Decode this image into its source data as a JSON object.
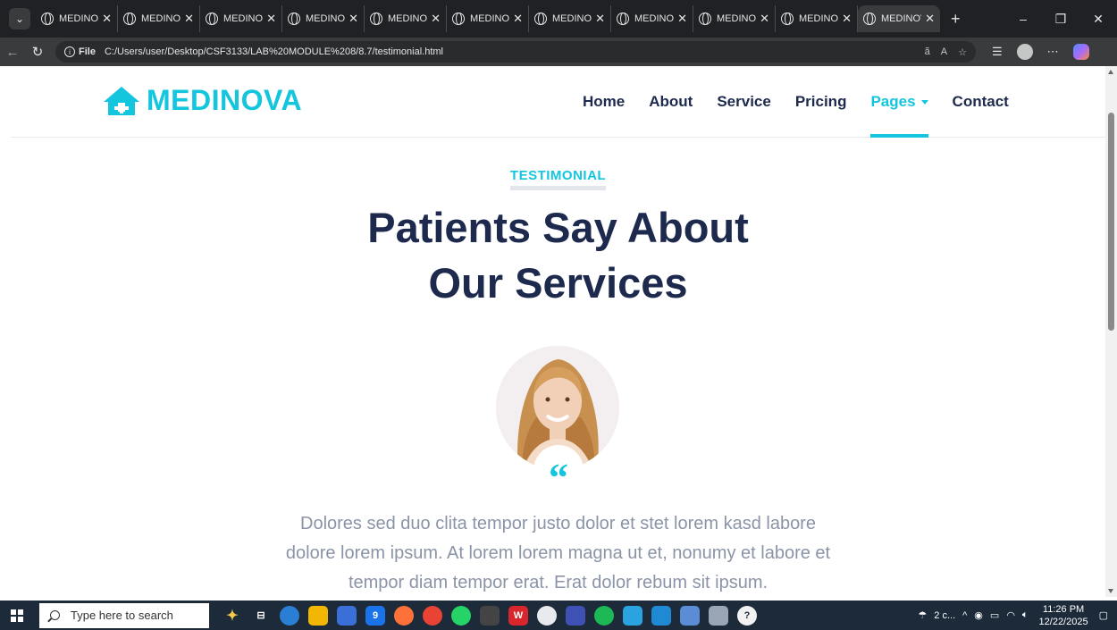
{
  "browser": {
    "tab_title": "MEDINOVA",
    "tab_count": 11,
    "new_tab_label": "+",
    "address": {
      "scheme_label": "File",
      "url": "C:/Users/user/Desktop/CSF3133/LAB%20MODULE%208/8.7/testimonial.html"
    }
  },
  "site": {
    "brand": "MEDINOVA",
    "nav": [
      {
        "label": "Home"
      },
      {
        "label": "About"
      },
      {
        "label": "Service"
      },
      {
        "label": "Pricing"
      },
      {
        "label": "Pages"
      },
      {
        "label": "Contact"
      }
    ],
    "section_tag": "TESTIMONIAL",
    "heading_line1": "Patients Say About",
    "heading_line2": "Our Services",
    "quote_mark": "“",
    "testimonial_line1": "Dolores sed duo clita tempor justo dolor et stet lorem kasd labore",
    "testimonial_line2": "dolore lorem ipsum. At lorem lorem magna ut et, nonumy et labore et",
    "testimonial_line3": "tempor diam tempor erat. Erat dolor rebum sit ipsum."
  },
  "colors": {
    "accent": "#13c5dd",
    "heading": "#1d2a4d",
    "body_text": "#8a94a6"
  },
  "taskbar": {
    "search_placeholder": "Type here to search",
    "weather": "2 c...",
    "time": "11:26 PM",
    "date": "12/22/2025",
    "mail_badge": "9"
  }
}
